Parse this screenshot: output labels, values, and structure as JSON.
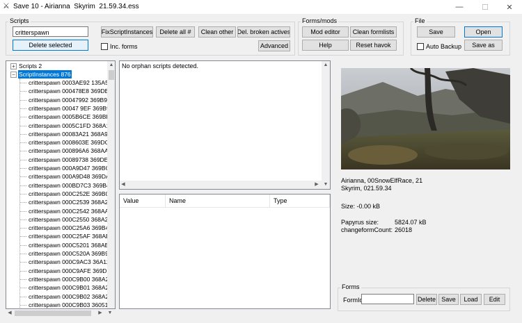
{
  "window": {
    "title": "Save 10 - Airianna  Skyrim  21.59.34.ess",
    "minimize": "—",
    "maximize": "☐",
    "close": "✕"
  },
  "scripts_group": {
    "label": "Scripts",
    "search_value": "critterspawn",
    "delete_selected": "Delete selected",
    "fix_script_instances": "FixScriptInstances",
    "delete_all": "Delete all #",
    "clean_other": "Clean other",
    "del_broken_actives": "Del. broken actives",
    "inc_forms_label": "Inc. forms",
    "advanced": "Advanced"
  },
  "forms_mods_group": {
    "label": "Forms/mods",
    "mod_editor": "Mod editor",
    "clean_formlists": "Clean formlists",
    "help": "Help",
    "reset_havok": "Reset havok"
  },
  "file_group": {
    "label": "File",
    "save": "Save",
    "open": "Open",
    "auto_backup_label": "Auto Backup",
    "save_as": "Save as"
  },
  "tree": {
    "root1": "Scripts 2",
    "root2": "ScriptInstances 876",
    "items": [
      "critterspawn 0003AE92 135A5",
      "critterspawn 000478E8 369DB",
      "critterspawn 00047992 369B97",
      "critterspawn 00047 9EF 369B9",
      "critterspawn 0005B6CE 369BB",
      "critterspawn 0005C1FD 368A1",
      "critterspawn 00083A21 368A9",
      "critterspawn 0008603E 369DC",
      "critterspawn 000896A6 368AA",
      "critterspawn 00089738 369DE",
      "critterspawn 000A9D47 369BC",
      "critterspawn 000A9D48 369DA",
      "critterspawn 000BD7C3 369B4",
      "critterspawn 000C252E 369B0",
      "critterspawn 000C2539 368A27",
      "critterspawn 000C2542 368AA",
      "critterspawn 000C2550 368A2",
      "critterspawn 000C25A6 369B4",
      "critterspawn 000C25AF 368AB",
      "critterspawn 000C5201 368AB",
      "critterspawn 000C520A 369B9",
      "critterspawn 000C9AC3 36A12",
      "critterspawn 000C9AFE 369DF",
      "critterspawn 000C9B00 368A2",
      "critterspawn 000C9B01 368A2",
      "critterspawn 000C9B02 368A2",
      "critterspawn 000C9B03 36051"
    ]
  },
  "message_panel": {
    "text": "No orphan scripts detected."
  },
  "variables_table": {
    "columns": [
      "Value",
      "Name",
      "Type"
    ]
  },
  "save_info": {
    "character": "Airianna, 00SnowElfRace, 21",
    "location": "Skyrim, 021.59.34",
    "size_label": "Size: -0.00 kB",
    "papyrus_label": "Papyrus size:",
    "papyrus_value": "5824.07 kB",
    "changeform_label": "changeformCount:",
    "changeform_value": "26018"
  },
  "forms_group": {
    "label": "Forms",
    "formid_label": "FormId",
    "formid_value": "",
    "delete": "Delete",
    "save": "Save",
    "load": "Load",
    "edit": "Edit"
  },
  "colors": {
    "accent": "#0078d7",
    "button_face": "#e1e1e1",
    "window_bg": "#f0f0f0"
  }
}
